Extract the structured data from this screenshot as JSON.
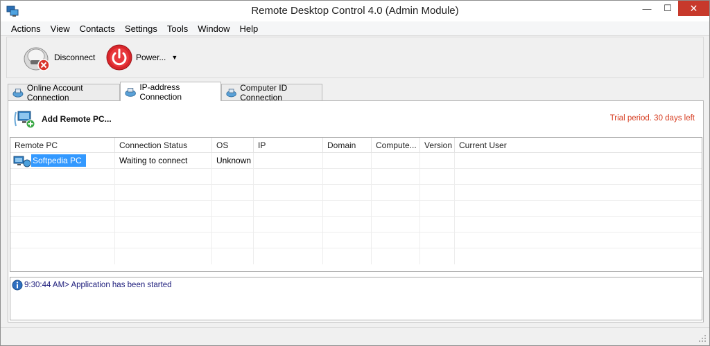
{
  "window": {
    "title": "Remote Desktop Control 4.0 (Admin Module)",
    "minimize_glyph": "—",
    "maximize_glyph": "☐",
    "close_glyph": "✕"
  },
  "menu": [
    "Actions",
    "View",
    "Contacts",
    "Settings",
    "Tools",
    "Window",
    "Help"
  ],
  "toolbar": {
    "disconnect_label": "Disconnect",
    "power_label": "Power...",
    "power_arrow": "▼"
  },
  "tabs": [
    {
      "label": "Online Account Connection",
      "icon": "network-globe-icon",
      "active": false
    },
    {
      "label": "IP-address Connection",
      "icon": "network-globe-icon",
      "active": true
    },
    {
      "label": "Computer ID Connection",
      "icon": "network-globe-icon",
      "active": false
    }
  ],
  "panel": {
    "add_remote_label": "Add Remote PC...",
    "trial_text": "Trial period. 30 days left"
  },
  "grid": {
    "columns": [
      "Remote PC",
      "Connection Status",
      "OS",
      "IP",
      "Domain",
      "Compute...",
      "Version",
      "Current User"
    ],
    "rows": [
      {
        "remote_pc": "Softpedia PC",
        "status": "Waiting to connect",
        "os": "Unknown",
        "ip": "",
        "domain": "",
        "computer": "",
        "version": "",
        "user": ""
      }
    ]
  },
  "log": {
    "lines": [
      "9:30:44 AM> Application has been started"
    ]
  },
  "colors": {
    "accent_selection": "#3399ff",
    "trial_text": "#d63b1f",
    "close_button": "#c7392b",
    "log_text": "#1a1a7a"
  }
}
